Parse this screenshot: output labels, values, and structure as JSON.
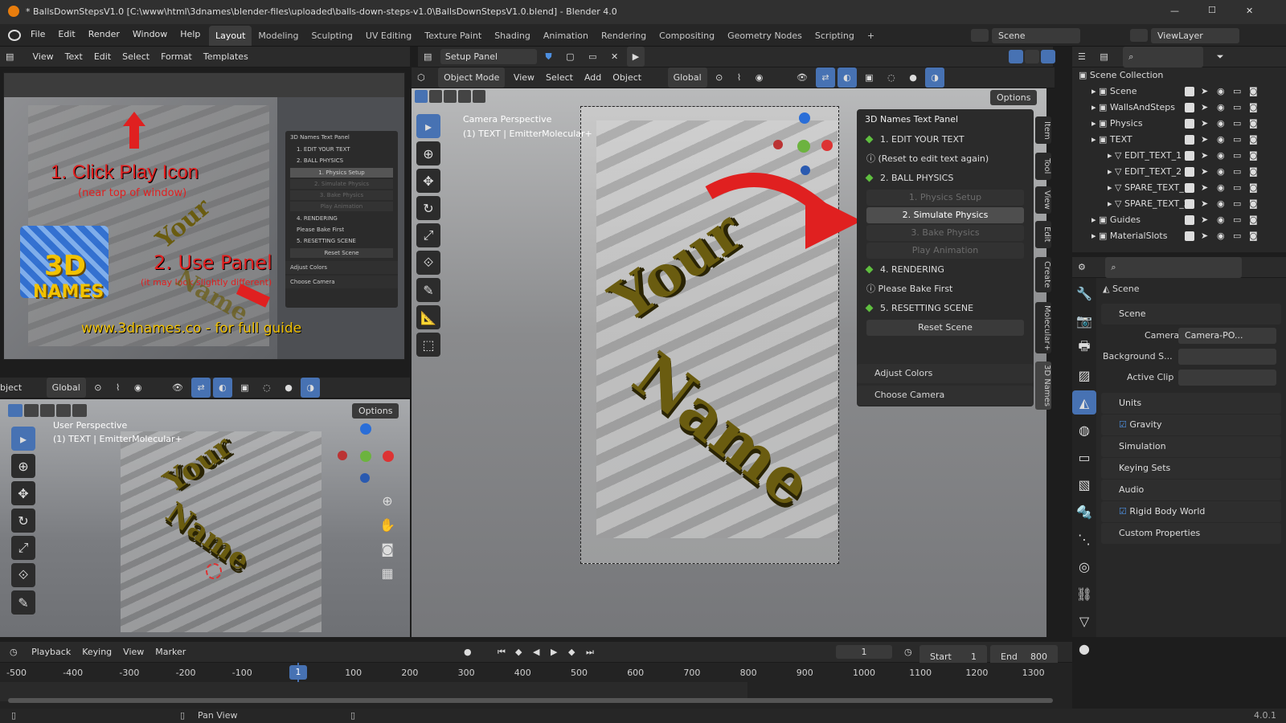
{
  "window": {
    "title": "* BallsDownStepsV1.0 [C:\\www\\html\\3dnames\\blender-files\\uploaded\\balls-down-steps-v1.0\\BallsDownStepsV1.0.blend] - Blender 4.0",
    "minimize": "—",
    "maximize": "☐",
    "close": "✕"
  },
  "menu": [
    "File",
    "Edit",
    "Render",
    "Window",
    "Help"
  ],
  "workspaces": [
    "Layout",
    "Modeling",
    "Sculpting",
    "UV Editing",
    "Texture Paint",
    "Shading",
    "Animation",
    "Rendering",
    "Compositing",
    "Geometry Nodes",
    "Scripting"
  ],
  "add_workspace": "+",
  "scene_selector": "Scene",
  "view_layer_selector": "ViewLayer",
  "text_editor": {
    "menu": [
      "View",
      "Text",
      "Edit",
      "Select",
      "Format",
      "Templates"
    ],
    "file_name": "Setup Panel"
  },
  "tutorial_image": {
    "step1": "1. Click Play Icon",
    "step1_sub": "(near top of window)",
    "step2": "2. Use Panel",
    "step2_sub": "(it may look slightly different)",
    "logo_top": "3D",
    "logo_bottom": "NAMES",
    "url": "www.3dnames.co - for full guide",
    "mini_panel": [
      "3D Names Text Panel",
      "1. EDIT YOUR TEXT",
      "2. BALL PHYSICS",
      "1. Physics Setup",
      "2. Simulate Physics",
      "3. Bake Physics",
      "Play Animation",
      "4. RENDERING",
      "Please Bake First",
      "5. RESETTING SCENE",
      "Reset Scene",
      "Adjust Colors",
      "Choose Camera"
    ],
    "mini_text_1": "Your",
    "mini_text_2": "Name"
  },
  "viewport_main": {
    "mode": "Object Mode",
    "menu": [
      "View",
      "Select",
      "Add",
      "Object"
    ],
    "transform": "Global",
    "options": "Options",
    "perspective": "Camera Perspective",
    "object": "(1) TEXT | EmitterMolecular+",
    "text_1": "Your",
    "text_2": "Name"
  },
  "n_panel": {
    "title": "3D Names Text Panel",
    "items": [
      {
        "label": "1. EDIT YOUR TEXT",
        "kind": "section"
      },
      {
        "label": "(Reset to edit text again)",
        "kind": "info"
      },
      {
        "label": "2. BALL PHYSICS",
        "kind": "section"
      },
      {
        "label": "1. Physics Setup",
        "kind": "dim"
      },
      {
        "label": "2. Simulate Physics",
        "kind": "highlight"
      },
      {
        "label": "3. Bake Physics",
        "kind": "dim"
      },
      {
        "label": "Play Animation",
        "kind": "dim"
      },
      {
        "label": "4. RENDERING",
        "kind": "section"
      },
      {
        "label": "Please Bake First",
        "kind": "info"
      },
      {
        "label": "5. RESETTING SCENE",
        "kind": "section"
      },
      {
        "label": "Reset Scene",
        "kind": "button"
      }
    ],
    "subpanels": [
      "Adjust Colors",
      "Choose Camera"
    ],
    "tabs": [
      "Item",
      "Tool",
      "View",
      "Edit",
      "Create",
      "Molecular+",
      "3D Names"
    ]
  },
  "viewport_small": {
    "mode_fragment": "bject",
    "transform": "Global",
    "options": "Options",
    "perspective": "User Perspective",
    "object": "(1) TEXT | EmitterMolecular+",
    "text_1": "Your",
    "text_2": "Name"
  },
  "outliner": {
    "root": "Scene Collection",
    "rows": [
      {
        "label": "Scene",
        "indent": 1
      },
      {
        "label": "WallsAndSteps",
        "indent": 1
      },
      {
        "label": "Physics",
        "indent": 1
      },
      {
        "label": "TEXT",
        "indent": 1
      },
      {
        "label": "EDIT_TEXT_1",
        "indent": 2
      },
      {
        "label": "EDIT_TEXT_2",
        "indent": 2
      },
      {
        "label": "SPARE_TEXT_1",
        "indent": 2
      },
      {
        "label": "SPARE_TEXT_2",
        "indent": 2
      },
      {
        "label": "Guides",
        "indent": 1
      },
      {
        "label": "MaterialSlots",
        "indent": 1
      }
    ]
  },
  "properties": {
    "context": "Scene",
    "section": "Scene",
    "camera_label": "Camera",
    "camera_value": "Camera-PO...",
    "background_label": "Background S...",
    "active_clip_label": "Active Clip",
    "panels": [
      {
        "label": "Units",
        "checkbox": false
      },
      {
        "label": "Gravity",
        "checkbox": true
      },
      {
        "label": "Simulation",
        "checkbox": false
      },
      {
        "label": "Keying Sets",
        "checkbox": false
      },
      {
        "label": "Audio",
        "checkbox": false
      },
      {
        "label": "Rigid Body World",
        "checkbox": true
      },
      {
        "label": "Custom Properties",
        "checkbox": false
      }
    ]
  },
  "timeline": {
    "menu": [
      "Playback",
      "Keying",
      "View",
      "Marker"
    ],
    "current_frame": "1",
    "start_label": "Start",
    "start_value": "1",
    "end_label": "End",
    "end_value": "800",
    "playhead": "1",
    "ticks": [
      "-500",
      "-400",
      "-300",
      "-200",
      "-100",
      "100",
      "200",
      "300",
      "400",
      "500",
      "600",
      "700",
      "800",
      "900",
      "1000",
      "1100",
      "1200",
      "1300"
    ]
  },
  "statusbar": {
    "action": "Pan View",
    "version": "4.0.1"
  },
  "colors": {
    "accent": "#4772b3",
    "red_arrow": "#e02020",
    "text_gold": "#6a5c10"
  }
}
